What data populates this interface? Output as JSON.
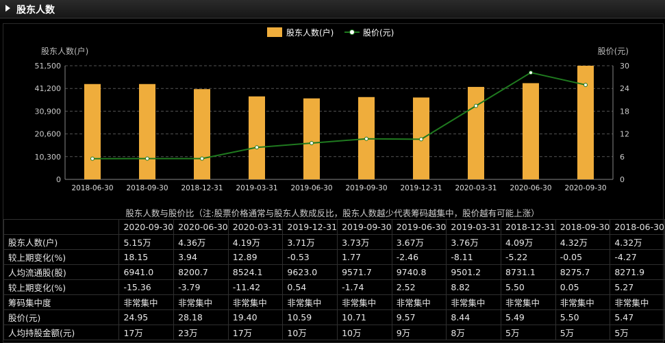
{
  "header": {
    "title": "股东人数"
  },
  "chart_data": {
    "type": "bar+line",
    "categories": [
      "2018-06-30",
      "2018-09-30",
      "2018-12-31",
      "2019-03-31",
      "2019-06-30",
      "2019-09-30",
      "2019-12-31",
      "2020-03-31",
      "2020-06-30",
      "2020-09-30"
    ],
    "series": [
      {
        "name": "股东人数(户)",
        "type": "bar",
        "axis": "left",
        "color": "#efad3c",
        "values": [
          43200,
          43200,
          40900,
          37600,
          36700,
          37300,
          37100,
          41900,
          43600,
          51500
        ]
      },
      {
        "name": "股价(元)",
        "type": "line",
        "axis": "right",
        "color": "#1f7a1f",
        "values": [
          5.47,
          5.5,
          5.49,
          8.44,
          9.57,
          10.71,
          10.59,
          19.4,
          28.18,
          24.95
        ]
      }
    ],
    "ylabel_left": "股东人数(户)",
    "ylabel_right": "股价(元)",
    "ylim_left": [
      0,
      51500
    ],
    "ylim_right": [
      0,
      30
    ],
    "yticks_left": [
      "0",
      "10,300",
      "20,600",
      "30,900",
      "41,200",
      "51,500"
    ],
    "yticks_right": [
      "0",
      "6",
      "12",
      "18",
      "24",
      "30"
    ],
    "grid": true,
    "legend_position": "top-center"
  },
  "caption": "股东人数与股价比（注:股票价格通常与股东人数成反比，股东人数越少代表筹码越集中，股价越有可能上涨）",
  "table": {
    "columns": [
      "2020-09-30",
      "2020-06-30",
      "2020-03-31",
      "2019-12-31",
      "2019-09-30",
      "2019-06-30",
      "2019-03-31",
      "2018-12-31",
      "2018-09-30",
      "2018-06-30"
    ],
    "rows": [
      {
        "label": "股东人数(户)",
        "values": [
          "5.15万",
          "4.36万",
          "4.19万",
          "3.71万",
          "3.73万",
          "3.67万",
          "3.76万",
          "4.09万",
          "4.32万",
          "4.32万"
        ]
      },
      {
        "label": "较上期变化(%)",
        "values": [
          "18.15",
          "3.94",
          "12.89",
          "-0.53",
          "1.77",
          "-2.46",
          "-8.11",
          "-5.22",
          "-0.05",
          "-4.27"
        ]
      },
      {
        "label": "人均流通股(股)",
        "values": [
          "6941.0",
          "8200.7",
          "8524.1",
          "9623.0",
          "9571.7",
          "9740.8",
          "9501.2",
          "8731.1",
          "8275.7",
          "8271.9"
        ]
      },
      {
        "label": "较上期变化(%)",
        "values": [
          "-15.36",
          "-3.79",
          "-11.42",
          "0.54",
          "-1.74",
          "2.52",
          "8.82",
          "5.50",
          "0.05",
          "5.27"
        ]
      },
      {
        "label": "筹码集中度",
        "values": [
          "非常集中",
          "非常集中",
          "非常集中",
          "非常集中",
          "非常集中",
          "非常集中",
          "非常集中",
          "非常集中",
          "非常集中",
          "非常集中"
        ]
      },
      {
        "label": "股价(元)",
        "values": [
          "24.95",
          "28.18",
          "19.40",
          "10.59",
          "10.71",
          "9.57",
          "8.44",
          "5.49",
          "5.50",
          "5.47"
        ]
      },
      {
        "label": "人均持股金额(元)",
        "values": [
          "17万",
          "23万",
          "17万",
          "10万",
          "10万",
          "9万",
          "8万",
          "5万",
          "5万",
          "5万"
        ]
      }
    ]
  }
}
